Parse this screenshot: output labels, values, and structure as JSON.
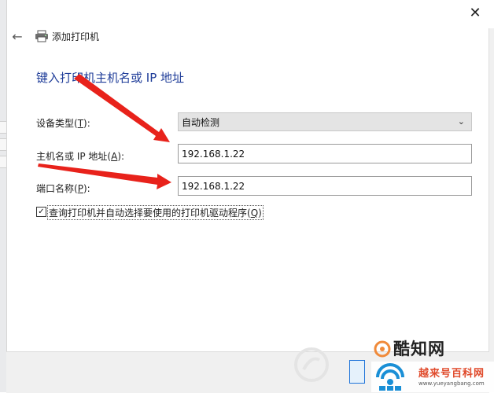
{
  "window": {
    "title": "添加打印机",
    "close_glyph": "✕",
    "back_glyph": "←"
  },
  "form": {
    "heading": "键入打印机主机名或 IP 地址",
    "device_type": {
      "label_pre": "设备类型(",
      "label_key": "T",
      "label_post": "):",
      "value": "自动检测"
    },
    "hostname": {
      "label_pre": "主机名或 IP 地址(",
      "label_key": "A",
      "label_post": "):",
      "value": "192.168.1.22"
    },
    "port": {
      "label_pre": "端口名称(",
      "label_key": "P",
      "label_post": "):",
      "value": "192.168.1.22"
    },
    "query_checkbox": {
      "checked": true,
      "label_pre": "查询打印机并自动选择要使用的打印机驱动程序(",
      "label_key": "Q",
      "label_post": ")"
    }
  },
  "watermarks": {
    "logo_text": "酷知网",
    "brand_text": "越来号百科网",
    "brand_url": "www.yueyangbang.com"
  },
  "colors": {
    "heading": "#1f3d99",
    "arrow": "#e8221b",
    "accent": "#1e73d9"
  },
  "icons": [
    "back-arrow-icon",
    "printer-icon",
    "close-icon",
    "chevron-down-icon",
    "checkmark-icon"
  ]
}
